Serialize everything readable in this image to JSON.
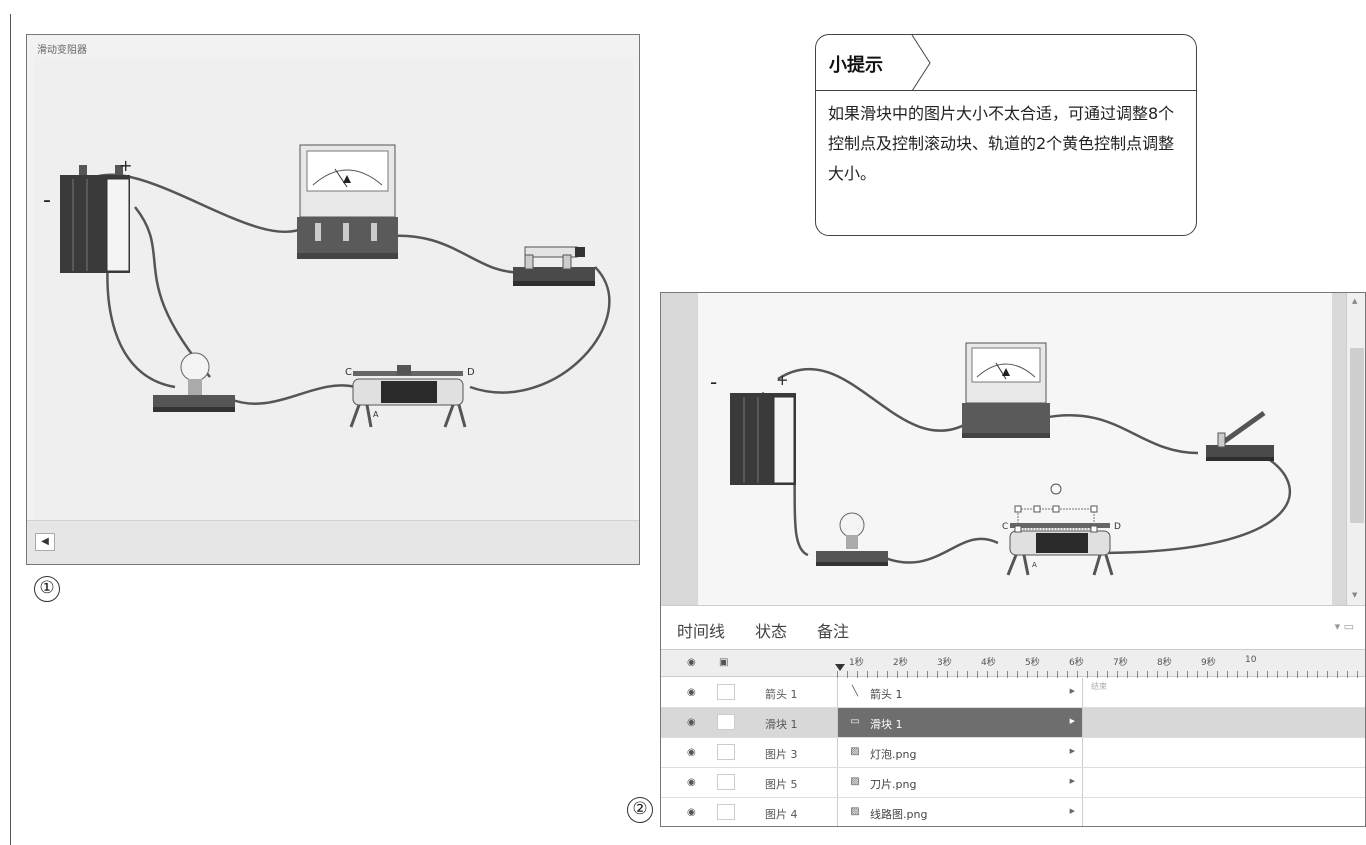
{
  "figure1": {
    "title": "滑动变阻器",
    "number": "①",
    "volume_icon": "speaker-icon",
    "terminal_minus": "-",
    "terminal_plus": "+"
  },
  "tip": {
    "heading": "小提示",
    "text": "如果滑块中的图片大小不太合适，可通过调整8个控制点及控制滚动块、轨道的2个黄色控制点调整大小。"
  },
  "figure2": {
    "number": "②",
    "terminal_minus": "-",
    "terminal_plus": "+",
    "tabs": [
      "时间线",
      "状态",
      "备注"
    ],
    "timeline": {
      "ticks": [
        "1秒",
        "2秒",
        "3秒",
        "4秒",
        "5秒",
        "6秒",
        "7秒",
        "8秒",
        "9秒",
        "10"
      ],
      "end_label": "结束",
      "rows": [
        {
          "layer": "箭头 1",
          "object": "箭头 1",
          "icon": "arrow-line-icon",
          "selected": false
        },
        {
          "layer": "滑块 1",
          "object": "滑块 1",
          "icon": "slider-icon",
          "selected": true
        },
        {
          "layer": "图片 3",
          "object": "灯泡.png",
          "icon": "image-icon",
          "selected": false
        },
        {
          "layer": "图片 5",
          "object": "刀片.png",
          "icon": "image-icon",
          "selected": false
        },
        {
          "layer": "图片 4",
          "object": "线路图.png",
          "icon": "image-icon",
          "selected": false
        }
      ]
    }
  },
  "circuit_labels": {
    "c": "C",
    "d": "D",
    "a": "A"
  }
}
